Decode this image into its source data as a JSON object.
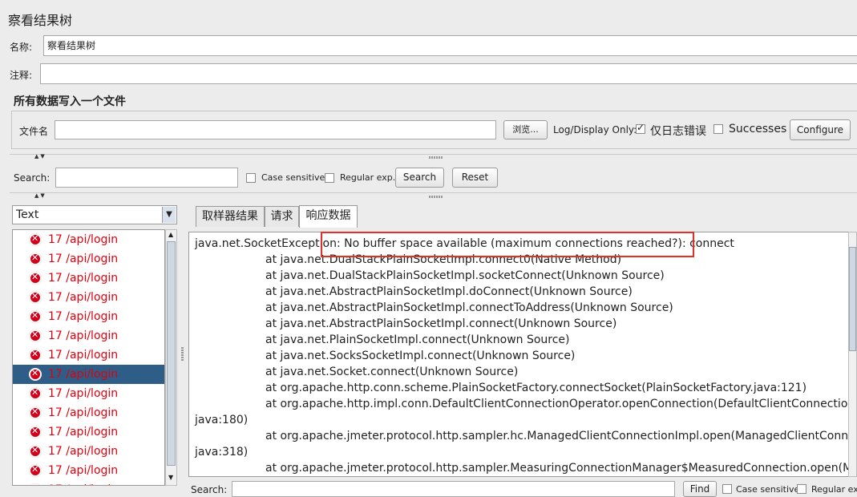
{
  "window": {
    "title": "察看结果树"
  },
  "name_row": {
    "label": "名称:",
    "value": "察看结果树"
  },
  "comment_row": {
    "label": "注释:",
    "value": ""
  },
  "file_section": {
    "title": "所有数据写入一个文件",
    "file_label": "文件名",
    "file_value": "",
    "browse_label": "浏览...",
    "log_display_label": "Log/Display Only:",
    "errors_only_label": "仅日志错误",
    "errors_only_checked": true,
    "successes_label": "Successes",
    "successes_checked": false,
    "configure_label": "Configure"
  },
  "search_bar": {
    "label": "Search:",
    "value": "",
    "case_sensitive_label": "Case sensitive",
    "regular_exp_label": "Regular exp.",
    "search_label": "Search",
    "reset_label": "Reset"
  },
  "renderer_select": {
    "value": "Text"
  },
  "results": [
    {
      "label": "17 /api/login",
      "status": "error",
      "selected": false
    },
    {
      "label": "17 /api/login",
      "status": "error",
      "selected": false
    },
    {
      "label": "17 /api/login",
      "status": "error",
      "selected": false
    },
    {
      "label": "17 /api/login",
      "status": "error",
      "selected": false
    },
    {
      "label": "17 /api/login",
      "status": "error",
      "selected": false
    },
    {
      "label": "17 /api/login",
      "status": "error",
      "selected": false
    },
    {
      "label": "17 /api/login",
      "status": "error",
      "selected": false
    },
    {
      "label": "17 /api/login",
      "status": "error",
      "selected": true
    },
    {
      "label": "17 /api/login",
      "status": "error",
      "selected": false
    },
    {
      "label": "17 /api/login",
      "status": "error",
      "selected": false
    },
    {
      "label": "17 /api/login",
      "status": "error",
      "selected": false
    },
    {
      "label": "17 /api/login",
      "status": "error",
      "selected": false
    },
    {
      "label": "17 /api/login",
      "status": "error",
      "selected": false
    },
    {
      "label": "17 /api/login",
      "status": "error",
      "selected": false
    }
  ],
  "tabs": [
    {
      "label": "取样器结果",
      "active": false
    },
    {
      "label": "请求",
      "active": false
    },
    {
      "label": "响应数据",
      "active": true
    }
  ],
  "response_lines": [
    {
      "text": "java.net.SocketException: No buffer space available (maximum connections reached?): connect",
      "indent": false
    },
    {
      "text": "at java.net.DualStackPlainSocketImpl.connect0(Native Method)",
      "indent": true
    },
    {
      "text": "at java.net.DualStackPlainSocketImpl.socketConnect(Unknown Source)",
      "indent": true
    },
    {
      "text": "at java.net.AbstractPlainSocketImpl.doConnect(Unknown Source)",
      "indent": true
    },
    {
      "text": "at java.net.AbstractPlainSocketImpl.connectToAddress(Unknown Source)",
      "indent": true
    },
    {
      "text": "at java.net.AbstractPlainSocketImpl.connect(Unknown Source)",
      "indent": true
    },
    {
      "text": "at java.net.PlainSocketImpl.connect(Unknown Source)",
      "indent": true
    },
    {
      "text": "at java.net.SocksSocketImpl.connect(Unknown Source)",
      "indent": true
    },
    {
      "text": "at java.net.Socket.connect(Unknown Source)",
      "indent": true
    },
    {
      "text": "at org.apache.http.conn.scheme.PlainSocketFactory.connectSocket(PlainSocketFactory.java:121)",
      "indent": true
    },
    {
      "text": "at org.apache.http.impl.conn.DefaultClientConnectionOperator.openConnection(DefaultClientConnectionOperator.",
      "indent": true
    },
    {
      "text": "java:180)",
      "indent": false
    },
    {
      "text": "at org.apache.jmeter.protocol.http.sampler.hc.ManagedClientConnectionImpl.open(ManagedClientConnectionImpl.",
      "indent": true
    },
    {
      "text": "java:318)",
      "indent": false
    },
    {
      "text": "at org.apache.jmeter.protocol.http.sampler.MeasuringConnectionManager$MeasuredConnection.open(Measuring",
      "indent": true
    }
  ],
  "bottom_search": {
    "label": "Search:",
    "find_label": "Find",
    "case_label": "Case sensitive",
    "regex_label": "Regular exp."
  },
  "colors": {
    "error_text": "#e1000d",
    "selection": "#2e5e88",
    "highlight_box": "#e0302a"
  }
}
